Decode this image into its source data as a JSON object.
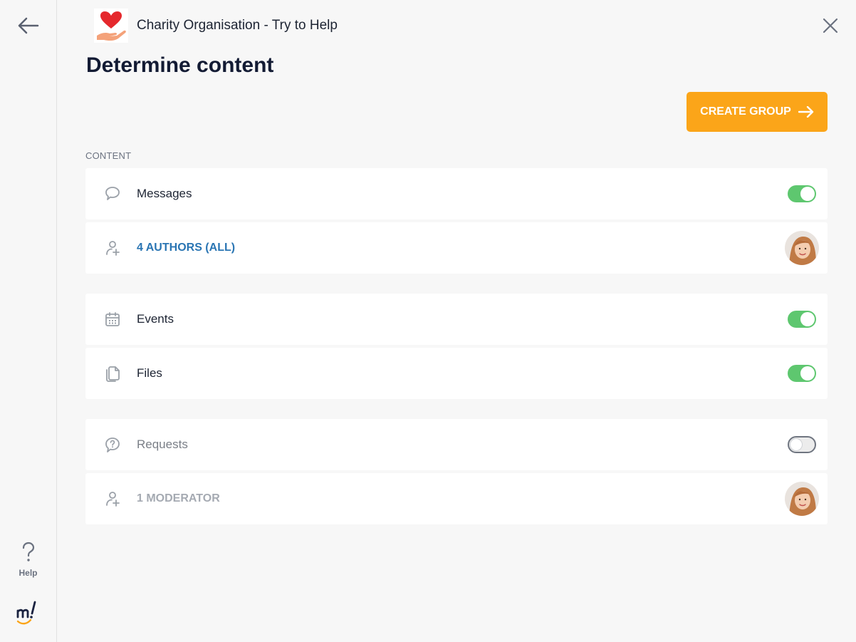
{
  "org": {
    "name": "Charity Organisation - Try to Help"
  },
  "page": {
    "title": "Determine content"
  },
  "actions": {
    "create_group": "CREATE GROUP"
  },
  "content": {
    "section_label": "CONTENT",
    "messages": {
      "label": "Messages",
      "enabled": true,
      "icon": "chat-bubble-icon"
    },
    "authors": {
      "label": "4 AUTHORS (ALL)",
      "icon": "user-plus-icon"
    },
    "events": {
      "label": "Events",
      "enabled": true,
      "icon": "calendar-icon"
    },
    "files": {
      "label": "Files",
      "enabled": true,
      "icon": "files-icon"
    },
    "requests": {
      "label": "Requests",
      "enabled": false,
      "icon": "question-bubble-icon"
    },
    "moderators": {
      "label": "1 MODERATOR",
      "icon": "user-plus-icon"
    }
  },
  "sidebar": {
    "help_label": "Help"
  },
  "colors": {
    "accent": "#fba519",
    "toggle_on": "#5ec76f",
    "link": "#2a75b3",
    "title": "#131b34"
  }
}
